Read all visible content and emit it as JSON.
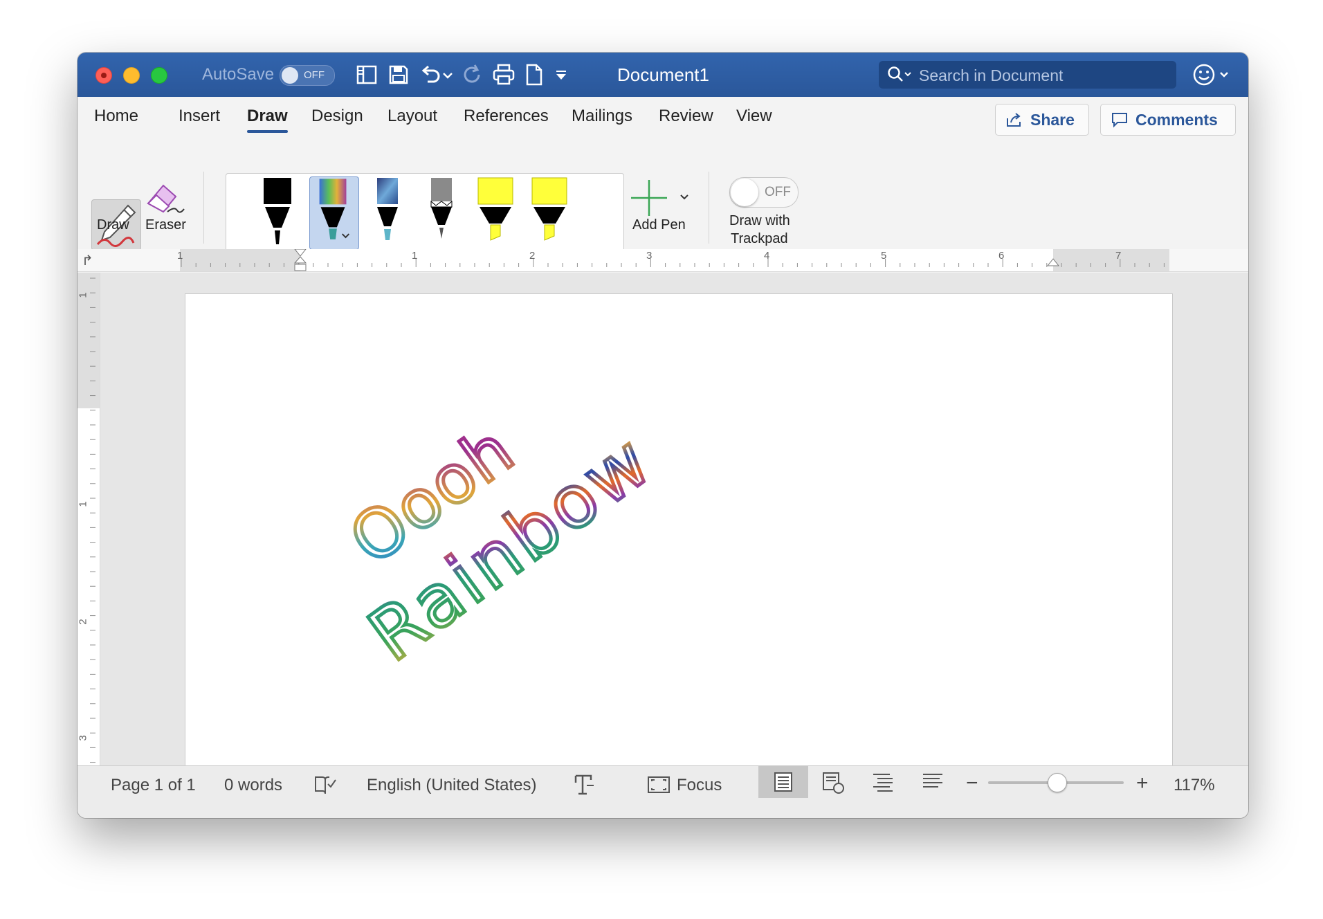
{
  "titlebar": {
    "autosave_label": "AutoSave",
    "autosave_state": "OFF",
    "document_title": "Document1",
    "search_placeholder": "Search in Document"
  },
  "tabs": [
    {
      "label": "Home"
    },
    {
      "label": "Insert"
    },
    {
      "label": "Draw",
      "active": true
    },
    {
      "label": "Design"
    },
    {
      "label": "Layout"
    },
    {
      "label": "References"
    },
    {
      "label": "Mailings"
    },
    {
      "label": "Review"
    },
    {
      "label": "View"
    }
  ],
  "actions": {
    "share_label": "Share",
    "comments_label": "Comments"
  },
  "ribbon": {
    "draw_label": "Draw",
    "eraser_label": "Eraser",
    "add_pen_label": "Add Pen",
    "trackpad_toggle_state": "OFF",
    "trackpad_label_line1": "Draw with",
    "trackpad_label_line2": "Trackpad",
    "pens": [
      {
        "name": "black-pen",
        "color": "#000000"
      },
      {
        "name": "rainbow-pen",
        "color": "rainbow",
        "selected": true
      },
      {
        "name": "galaxy-pen",
        "color": "galaxy"
      },
      {
        "name": "pencil",
        "color": "#8a8a8a"
      },
      {
        "name": "yellow-highlighter-1",
        "color": "#ffff3a"
      },
      {
        "name": "yellow-highlighter-2",
        "color": "#ffff3a"
      }
    ]
  },
  "ruler": {
    "horizontal_labels": [
      "1",
      "1",
      "2",
      "3",
      "4",
      "5",
      "6",
      "7"
    ],
    "vertical_labels": [
      "1",
      "1",
      "2",
      "3"
    ]
  },
  "document": {
    "ink_line1": "Oooh",
    "ink_line2": "Rainbow"
  },
  "status": {
    "page": "Page 1 of 1",
    "words": "0 words",
    "language": "English (United States)",
    "focus": "Focus",
    "zoom": "117%",
    "zoom_minus": "−",
    "zoom_plus": "+"
  }
}
